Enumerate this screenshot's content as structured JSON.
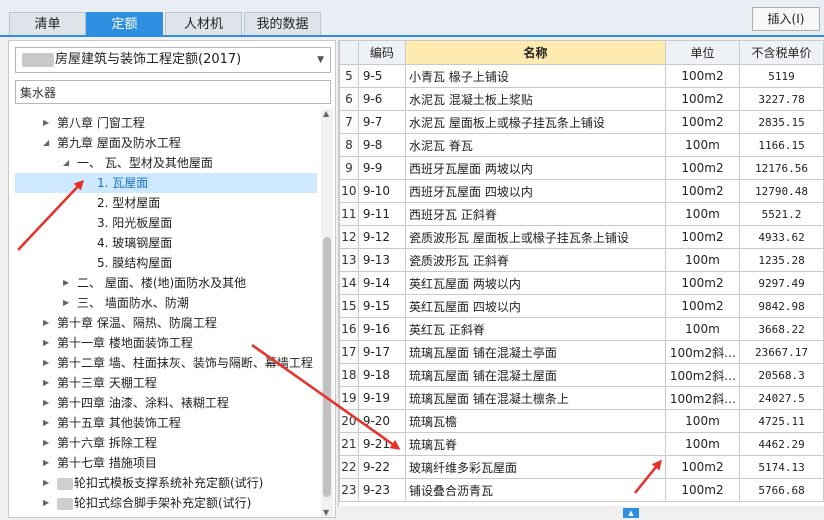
{
  "tabs": [
    {
      "label": "清单",
      "active": false
    },
    {
      "label": "定额",
      "active": true
    },
    {
      "label": "人材机",
      "active": false
    },
    {
      "label": "我的数据",
      "active": false
    }
  ],
  "toolbar": {
    "insert_label": "插入(I)"
  },
  "quota_library": {
    "selected": "房屋建筑与装饰工程定额(2017)"
  },
  "search": {
    "value": "集水器"
  },
  "tree": [
    {
      "level": 1,
      "arrow": "collapsed",
      "label": "第八章 门窗工程"
    },
    {
      "level": 1,
      "arrow": "expanded",
      "label": "第九章 屋面及防水工程"
    },
    {
      "level": 2,
      "arrow": "expanded",
      "label": "一、 瓦、型材及其他屋面"
    },
    {
      "level": 3,
      "arrow": "none",
      "label": "1. 瓦屋面",
      "selected": true
    },
    {
      "level": 3,
      "arrow": "none",
      "label": "2. 型材屋面"
    },
    {
      "level": 3,
      "arrow": "none",
      "label": "3. 阳光板屋面"
    },
    {
      "level": 3,
      "arrow": "none",
      "label": "4. 玻璃钢屋面"
    },
    {
      "level": 3,
      "arrow": "none",
      "label": "5. 膜结构屋面"
    },
    {
      "level": 2,
      "arrow": "collapsed",
      "label": "二、 屋面、楼(地)面防水及其他"
    },
    {
      "level": 2,
      "arrow": "collapsed",
      "label": "三、 墙面防水、防潮"
    },
    {
      "level": 1,
      "arrow": "collapsed",
      "label": "第十章 保温、隔热、防腐工程"
    },
    {
      "level": 1,
      "arrow": "collapsed",
      "label": "第十一章 楼地面装饰工程"
    },
    {
      "level": 1,
      "arrow": "collapsed",
      "label": "第十二章 墙、柱面抹灰、装饰与隔断、幕墙工程"
    },
    {
      "level": 1,
      "arrow": "collapsed",
      "label": "第十三章 天棚工程"
    },
    {
      "level": 1,
      "arrow": "collapsed",
      "label": "第十四章 油漆、涂料、裱糊工程"
    },
    {
      "level": 1,
      "arrow": "collapsed",
      "label": "第十五章 其他装饰工程"
    },
    {
      "level": 1,
      "arrow": "collapsed",
      "label": "第十六章 拆除工程"
    },
    {
      "level": 1,
      "arrow": "collapsed",
      "label": "第十七章 措施项目"
    },
    {
      "level": 1,
      "arrow": "collapsed",
      "label": "轮扣式模板支撑系统补充定额(试行)",
      "blurred_prefix": true
    },
    {
      "level": 1,
      "arrow": "collapsed",
      "label": "轮扣式综合脚手架补充定额(试行)",
      "blurred_prefix": true
    }
  ],
  "table": {
    "headers": {
      "code": "编码",
      "name": "名称",
      "unit": "单位",
      "price": "不含税单价"
    },
    "rows": [
      {
        "n": "5",
        "code": "9-5",
        "name": "小青瓦 椽子上铺设",
        "unit": "100m2",
        "price": "5119"
      },
      {
        "n": "6",
        "code": "9-6",
        "name": "水泥瓦 混凝土板上浆贴",
        "unit": "100m2",
        "price": "3227.78"
      },
      {
        "n": "7",
        "code": "9-7",
        "name": "水泥瓦 屋面板上或椽子挂瓦条上铺设",
        "unit": "100m2",
        "price": "2835.15"
      },
      {
        "n": "8",
        "code": "9-8",
        "name": "水泥瓦 脊瓦",
        "unit": "100m",
        "price": "1166.15"
      },
      {
        "n": "9",
        "code": "9-9",
        "name": "西班牙瓦屋面 两坡以内",
        "unit": "100m2",
        "price": "12176.56"
      },
      {
        "n": "10",
        "code": "9-10",
        "name": "西班牙瓦屋面 四坡以内",
        "unit": "100m2",
        "price": "12790.48"
      },
      {
        "n": "11",
        "code": "9-11",
        "name": "西班牙瓦 正斜脊",
        "unit": "100m",
        "price": "5521.2"
      },
      {
        "n": "12",
        "code": "9-12",
        "name": "瓷质波形瓦 屋面板上或椽子挂瓦条上铺设",
        "unit": "100m2",
        "price": "4933.62"
      },
      {
        "n": "13",
        "code": "9-13",
        "name": "瓷质波形瓦 正斜脊",
        "unit": "100m",
        "price": "1235.28"
      },
      {
        "n": "14",
        "code": "9-14",
        "name": "英红瓦屋面 两坡以内",
        "unit": "100m2",
        "price": "9297.49"
      },
      {
        "n": "15",
        "code": "9-15",
        "name": "英红瓦屋面 四坡以内",
        "unit": "100m2",
        "price": "9842.98"
      },
      {
        "n": "16",
        "code": "9-16",
        "name": "英红瓦 正斜脊",
        "unit": "100m",
        "price": "3668.22"
      },
      {
        "n": "17",
        "code": "9-17",
        "name": "琉璃瓦屋面 铺在混凝土亭面",
        "unit": "100m2斜…",
        "price": "23667.17"
      },
      {
        "n": "18",
        "code": "9-18",
        "name": "琉璃瓦屋面 铺在混凝土屋面",
        "unit": "100m2斜…",
        "price": "20568.3"
      },
      {
        "n": "19",
        "code": "9-19",
        "name": "琉璃瓦屋面 铺在混凝土檩条上",
        "unit": "100m2斜…",
        "price": "24027.5"
      },
      {
        "n": "20",
        "code": "9-20",
        "name": "琉璃瓦檐",
        "unit": "100m",
        "price": "4725.11"
      },
      {
        "n": "21",
        "code": "9-21",
        "name": "琉璃瓦脊",
        "unit": "100m",
        "price": "4462.29"
      },
      {
        "n": "22",
        "code": "9-22",
        "name": "玻璃纤维多彩瓦屋面",
        "unit": "100m2",
        "price": "5174.13"
      },
      {
        "n": "23",
        "code": "9-23",
        "name": "铺设叠合沥青瓦",
        "unit": "100m2",
        "price": "5766.68"
      }
    ]
  },
  "annotation_color": "#e8302a"
}
